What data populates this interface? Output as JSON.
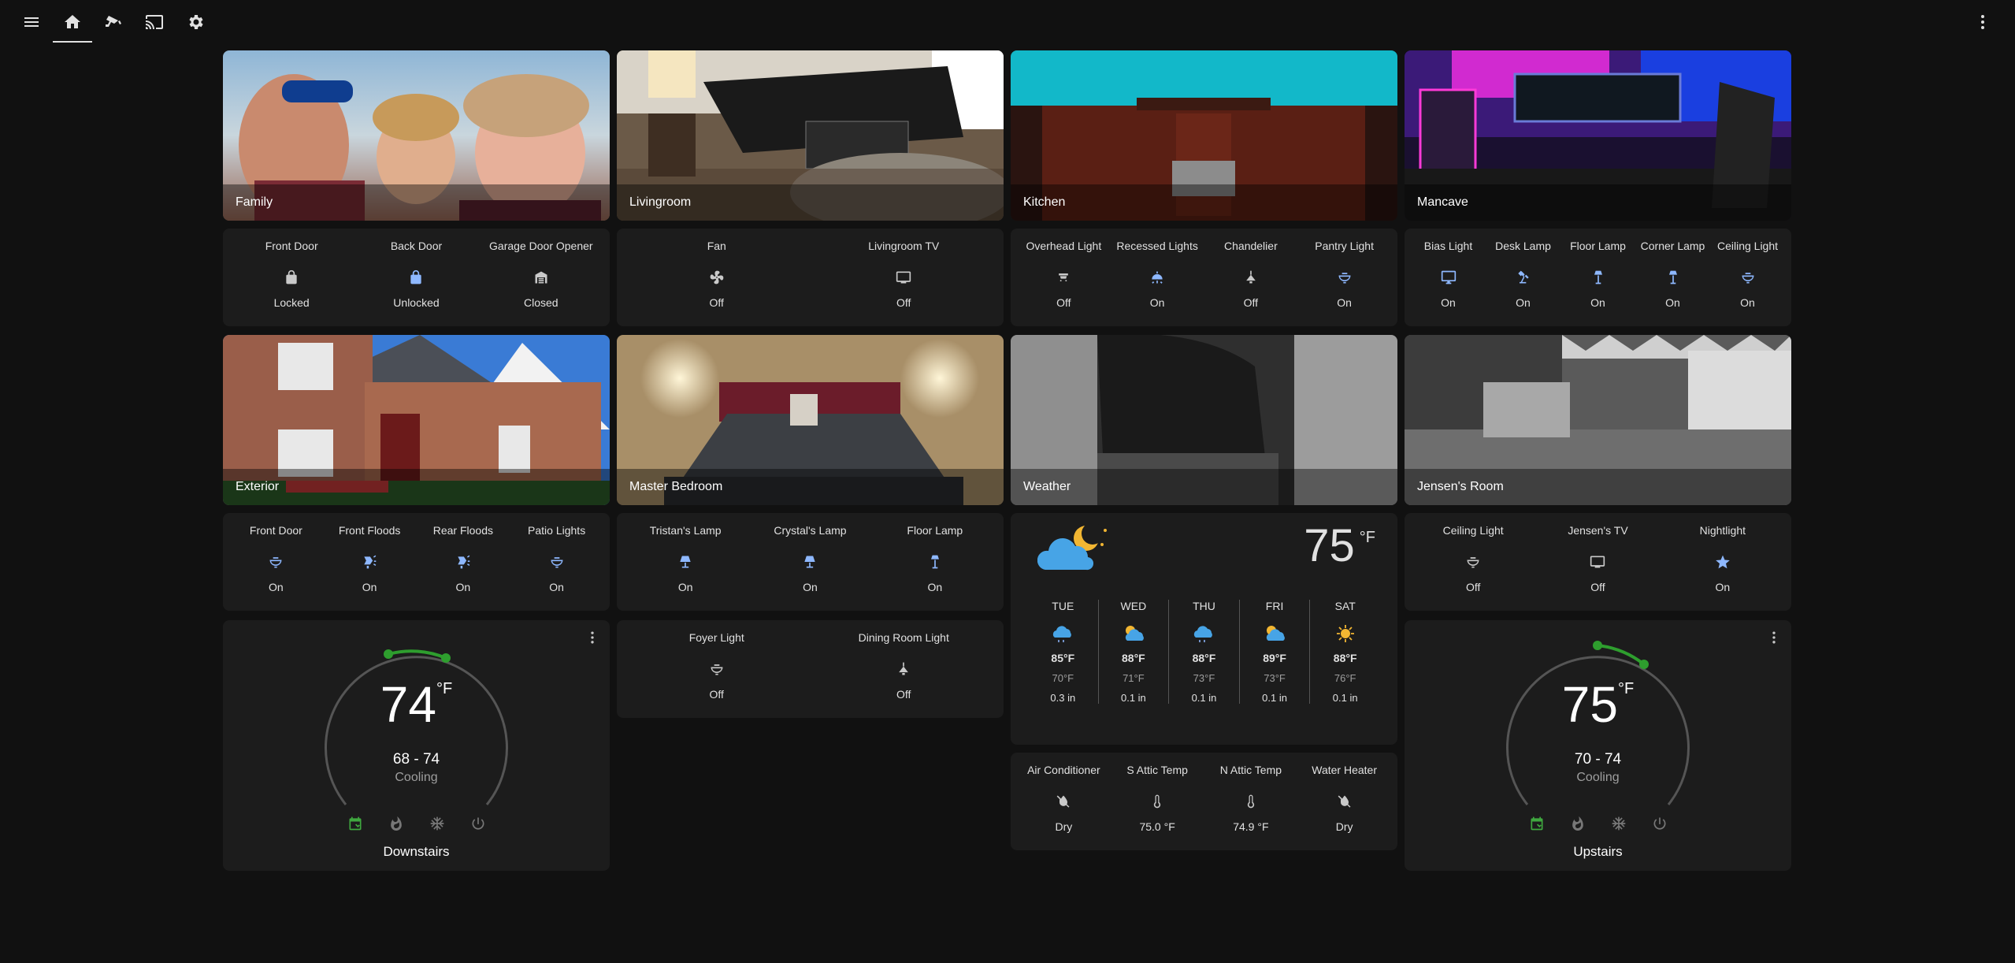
{
  "topbar": {
    "icons": [
      "menu-icon",
      "home-icon",
      "cctv-icon",
      "cast-icon",
      "gear-icon",
      "more-vertical-icon"
    ]
  },
  "pictures": {
    "family": "Family",
    "livingroom": "Livingroom",
    "kitchen": "Kitchen",
    "mancave": "Mancave",
    "exterior": "Exterior",
    "master_bedroom": "Master Bedroom",
    "weather": "Weather",
    "jensens_room": "Jensen's Room"
  },
  "family_entities": [
    {
      "name": "Front Door",
      "state": "Locked",
      "icon": "lock-icon"
    },
    {
      "name": "Back Door",
      "state": "Unlocked",
      "icon": "lock-open-icon"
    },
    {
      "name": "Garage Door Opener",
      "state": "Closed",
      "icon": "garage-icon"
    }
  ],
  "livingroom_entities": [
    {
      "name": "Fan",
      "state": "Off",
      "icon": "fan-icon"
    },
    {
      "name": "Livingroom TV",
      "state": "Off",
      "icon": "tv-icon"
    }
  ],
  "kitchen_entities": [
    {
      "name": "Overhead Light",
      "state": "Off",
      "icon": "ceiling-light-icon"
    },
    {
      "name": "Recessed Lights",
      "state": "On",
      "icon": "spotlight-icon"
    },
    {
      "name": "Chandelier",
      "state": "Off",
      "icon": "chandelier-icon"
    },
    {
      "name": "Pantry Light",
      "state": "On",
      "icon": "bulb-bowl-icon"
    }
  ],
  "mancave_entities": [
    {
      "name": "Bias Light",
      "state": "On",
      "icon": "monitor-icon"
    },
    {
      "name": "Desk Lamp",
      "state": "On",
      "icon": "desk-lamp-icon"
    },
    {
      "name": "Floor Lamp",
      "state": "On",
      "icon": "floor-lamp-icon"
    },
    {
      "name": "Corner Lamp",
      "state": "On",
      "icon": "floor-lamp-icon"
    },
    {
      "name": "Ceiling Light",
      "state": "On",
      "icon": "bulb-bowl-icon"
    }
  ],
  "exterior_entities": [
    {
      "name": "Front Door",
      "state": "On",
      "icon": "bulb-bowl-icon"
    },
    {
      "name": "Front Floods",
      "state": "On",
      "icon": "flood-light-icon"
    },
    {
      "name": "Rear Floods",
      "state": "On",
      "icon": "flood-light-icon"
    },
    {
      "name": "Patio Lights",
      "state": "On",
      "icon": "bulb-bowl-icon"
    }
  ],
  "bedroom_entities": [
    {
      "name": "Tristan's Lamp",
      "state": "On",
      "icon": "table-lamp-icon"
    },
    {
      "name": "Crystal's Lamp",
      "state": "On",
      "icon": "table-lamp-icon"
    },
    {
      "name": "Floor Lamp",
      "state": "On",
      "icon": "floor-lamp-icon"
    }
  ],
  "foyer_entities": [
    {
      "name": "Foyer Light",
      "state": "Off",
      "icon": "bulb-bowl-icon"
    },
    {
      "name": "Dining Room Light",
      "state": "Off",
      "icon": "chandelier-icon"
    }
  ],
  "jensen_entities": [
    {
      "name": "Ceiling Light",
      "state": "Off",
      "icon": "bulb-bowl-icon"
    },
    {
      "name": "Jensen's TV",
      "state": "Off",
      "icon": "tv-icon"
    },
    {
      "name": "Nightlight",
      "state": "On",
      "icon": "star-icon"
    }
  ],
  "sensors_entities": [
    {
      "name": "Air Conditioner",
      "state": "Dry",
      "icon": "water-off-icon"
    },
    {
      "name": "S Attic Temp",
      "state": "75.0 °F",
      "icon": "thermometer-icon"
    },
    {
      "name": "N Attic Temp",
      "state": "74.9 °F",
      "icon": "thermometer-icon"
    },
    {
      "name": "Water Heater",
      "state": "Dry",
      "icon": "water-off-icon"
    }
  ],
  "weather": {
    "icon": "partly-cloudy-night-icon",
    "temperature": "75",
    "unit": "°F",
    "forecast": [
      {
        "day": "TUE",
        "hi": "85°F",
        "lo": "70°F",
        "precip": "0.3 in",
        "icon": "rain-icon"
      },
      {
        "day": "WED",
        "hi": "88°F",
        "lo": "71°F",
        "precip": "0.1 in",
        "icon": "partly-cloudy-icon"
      },
      {
        "day": "THU",
        "hi": "88°F",
        "lo": "73°F",
        "precip": "0.1 in",
        "icon": "rain-icon"
      },
      {
        "day": "FRI",
        "hi": "89°F",
        "lo": "73°F",
        "precip": "0.1 in",
        "icon": "partly-cloudy-icon"
      },
      {
        "day": "SAT",
        "hi": "88°F",
        "lo": "76°F",
        "precip": "0.1 in",
        "icon": "sunny-icon"
      }
    ]
  },
  "thermostats": {
    "downstairs": {
      "current": "74",
      "unit": "°F",
      "range": "68 - 74",
      "mode": "Cooling",
      "name": "Downstairs"
    },
    "upstairs": {
      "current": "75",
      "unit": "°F",
      "range": "70 - 74",
      "mode": "Cooling",
      "name": "Upstairs"
    }
  },
  "colors": {
    "background": "#111111",
    "card": "#1c1c1c",
    "on_icon": "#8eb8ff",
    "off_icon": "#c9c9c9",
    "heat_cool_active": "#3fa83f"
  }
}
